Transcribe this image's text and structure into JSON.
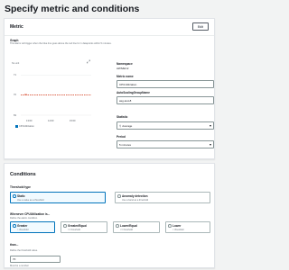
{
  "page": {
    "title": "Specify metric and conditions"
  },
  "metric_card": {
    "title": "Metric",
    "edit_label": "Edit",
    "graph": {
      "title": "Graph",
      "description": "This alarm will trigger when the blue line goes above the red line for 1 datapoints within 5 minutes.",
      "unit": "No unit",
      "y_ticks": [
        "71",
        "70",
        "69"
      ],
      "x_ticks": [
        "13:00",
        "14:00",
        "15:00"
      ],
      "legend": "CPUUtilization",
      "threshold_label": "70",
      "colors": {
        "metric_line": "#0073bb",
        "threshold_line": "#d13212"
      }
    },
    "namespace_label": "Namespace",
    "namespace_value": "AWS/EC2",
    "metric_name_label": "Metric name",
    "metric_name_value": "CPUUtilization",
    "asg_label": "AutoScalingGroupName",
    "asg_value": "asg-test-8",
    "statistic_label": "Statistic",
    "statistic_value": "Average",
    "period_label": "Period",
    "period_value": "5 minutes"
  },
  "conditions_card": {
    "title": "Conditions",
    "threshold_type_label": "Threshold type",
    "threshold_types": [
      {
        "title": "Static",
        "desc": "Use a value as a threshold",
        "selected": true
      },
      {
        "title": "Anomaly detection",
        "desc": "Use a band as a threshold",
        "selected": false
      }
    ],
    "whenever_label": "Whenever CPUUtilization is...",
    "whenever_hint": "Define the alarm condition.",
    "operators": [
      {
        "title": "Greater",
        "desc": "> threshold",
        "selected": true
      },
      {
        "title": "Greater/Equal",
        "desc": ">= threshold",
        "selected": false
      },
      {
        "title": "Lower/Equal",
        "desc": "<= threshold",
        "selected": false
      },
      {
        "title": "Lower",
        "desc": "< threshold",
        "selected": false
      }
    ],
    "than_label": "than...",
    "than_hint": "Define the threshold value.",
    "threshold_value": "70",
    "must_be_number": "Must be a number"
  }
}
